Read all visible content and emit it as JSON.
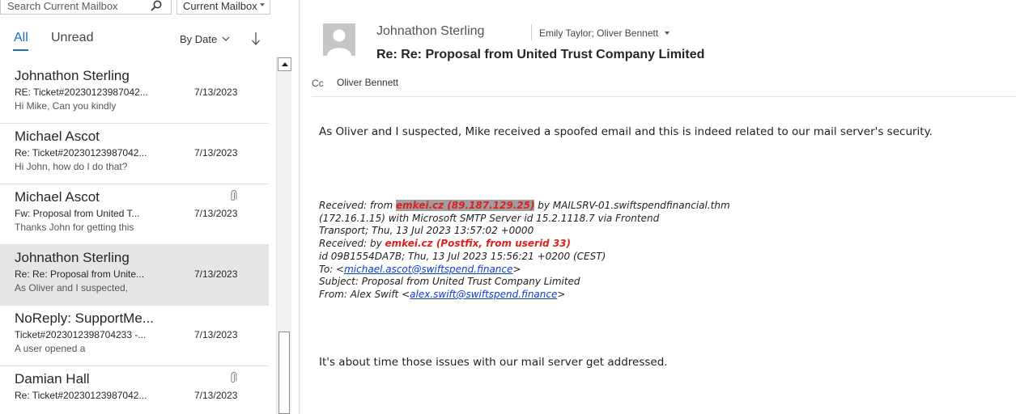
{
  "search": {
    "placeholder": "Search Current Mailbox",
    "scope": "Current Mailbox"
  },
  "filters": {
    "all": "All",
    "unread": "Unread",
    "sort": "By Date"
  },
  "messages": [
    {
      "sender": "Johnathon Sterling",
      "subject": "RE: Ticket#20230123987042...",
      "date": "7/13/2023",
      "preview": "Hi Mike,  Can you kindly",
      "attachment": false,
      "selected": false
    },
    {
      "sender": "Michael Ascot",
      "subject": "Re: Ticket#20230123987042...",
      "date": "7/13/2023",
      "preview": "Hi John, how do I do that?",
      "attachment": false,
      "selected": false
    },
    {
      "sender": "Michael Ascot",
      "subject": "Fw: Proposal from United T...",
      "date": "7/13/2023",
      "preview": "Thanks John for getting this",
      "attachment": true,
      "selected": false
    },
    {
      "sender": "Johnathon Sterling",
      "subject": "Re: Re: Proposal from Unite...",
      "date": "7/13/2023",
      "preview": "As Oliver and I suspected,",
      "attachment": false,
      "selected": true
    },
    {
      "sender": "NoReply: SupportMe...",
      "subject": "Ticket#2023012398704233 -...",
      "date": "7/13/2023",
      "preview": "A user opened a",
      "attachment": false,
      "selected": false
    },
    {
      "sender": "Damian Hall",
      "subject": "Re: Ticket#20230123987042...",
      "date": "7/13/2023",
      "preview": "",
      "attachment": true,
      "selected": false
    }
  ],
  "reading": {
    "from": "Johnathon Sterling",
    "to": "Emily Taylor; Oliver Bennett",
    "subject": "Re: Re: Proposal from United Trust Company Limited",
    "cc_label": "Cc",
    "cc": "Oliver Bennett",
    "body_intro": "As Oliver and I suspected, Mike received a spoofed email and this is indeed related to our mail server's security.",
    "headers": {
      "l1_a": "Received: from ",
      "l1_host": "emkei.cz",
      "l1_ip": " (89.187.129.25)",
      "l1_b": " by MAILSRV-01.swiftspendfinancial.thm",
      "l2": " (172.16.1.15) with Microsoft SMTP Server id 15.2.1118.7 via Frontend",
      "l3": " Transport; Thu, 13 Jul 2023 13:57:02 +0000",
      "l4_a": "Received: by ",
      "l4_b": "emkei.cz (Postfix, from userid 33)",
      "l5": "id 09B1554DA7B; Thu, 13 Jul 2023 15:56:21 +0200 (CEST)",
      "l6_a": "To: <",
      "l6_link": "michael.ascot@swiftspend.finance",
      "l6_b": ">",
      "l7": "Subject: Proposal from United Trust Company Limited",
      "l8_a": "From: Alex Swift <",
      "l8_link": "alex.swift@swiftspend.finance",
      "l8_b": ">"
    },
    "body_outro": "It's about time those issues with our mail server get addressed."
  },
  "colors": {
    "accent": "#1a6fc1",
    "selected_row": "#e6e6e6",
    "header_red": "#e0201c",
    "link": "#0b3dd6"
  },
  "icons": [
    "search-icon",
    "chevron-down-icon",
    "sort-arrow-icon",
    "attachment-icon",
    "scroll-up-icon",
    "avatar-placeholder-icon"
  ]
}
